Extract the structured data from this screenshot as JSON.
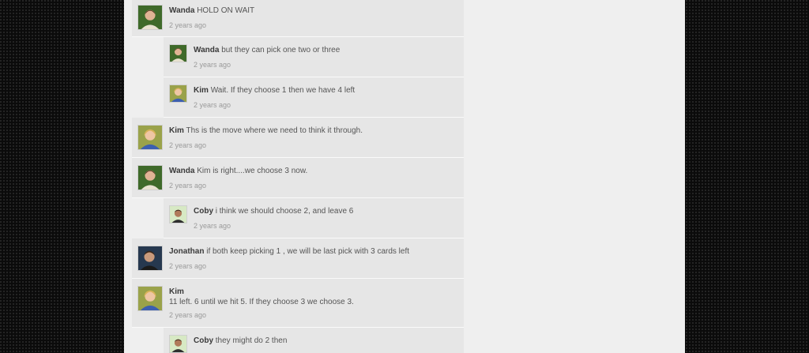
{
  "comments": [
    {
      "author": "Wanda",
      "text": "HOLD ON WAIT",
      "time": "2 years ago",
      "avatar": "wanda-avatar"
    },
    {
      "author": "Wanda",
      "text": "but they can pick one two or three",
      "time": "2 years ago",
      "avatar": "wanda-avatar"
    },
    {
      "author": "Kim",
      "text": "Wait. If they choose 1 then we have 4 left",
      "time": "2 years ago",
      "avatar": "kim-avatar"
    },
    {
      "author": "Kim",
      "text": "Ths is the move where we need to think it through.",
      "time": "2 years ago",
      "avatar": "kim-avatar"
    },
    {
      "author": "Wanda",
      "text": "Kim is right....we choose 3 now.",
      "time": "2 years ago",
      "avatar": "wanda-avatar"
    },
    {
      "author": "Coby",
      "text": "i think we should choose 2, and leave 6",
      "time": "2 years ago",
      "avatar": "coby-avatar"
    },
    {
      "author": "Jonathan",
      "text": "if both keep picking 1 , we will be last pick with 3 cards left",
      "time": "2 years ago",
      "avatar": "jonathan-avatar"
    },
    {
      "author": "Kim",
      "text": "11 left. 6 until we hit 5. If they choose 3 we choose 3.",
      "time": "2 years ago",
      "avatar": "kim-avatar"
    },
    {
      "author": "Coby",
      "text": "they might do 2 then",
      "time": "",
      "avatar": "coby-avatar"
    }
  ]
}
